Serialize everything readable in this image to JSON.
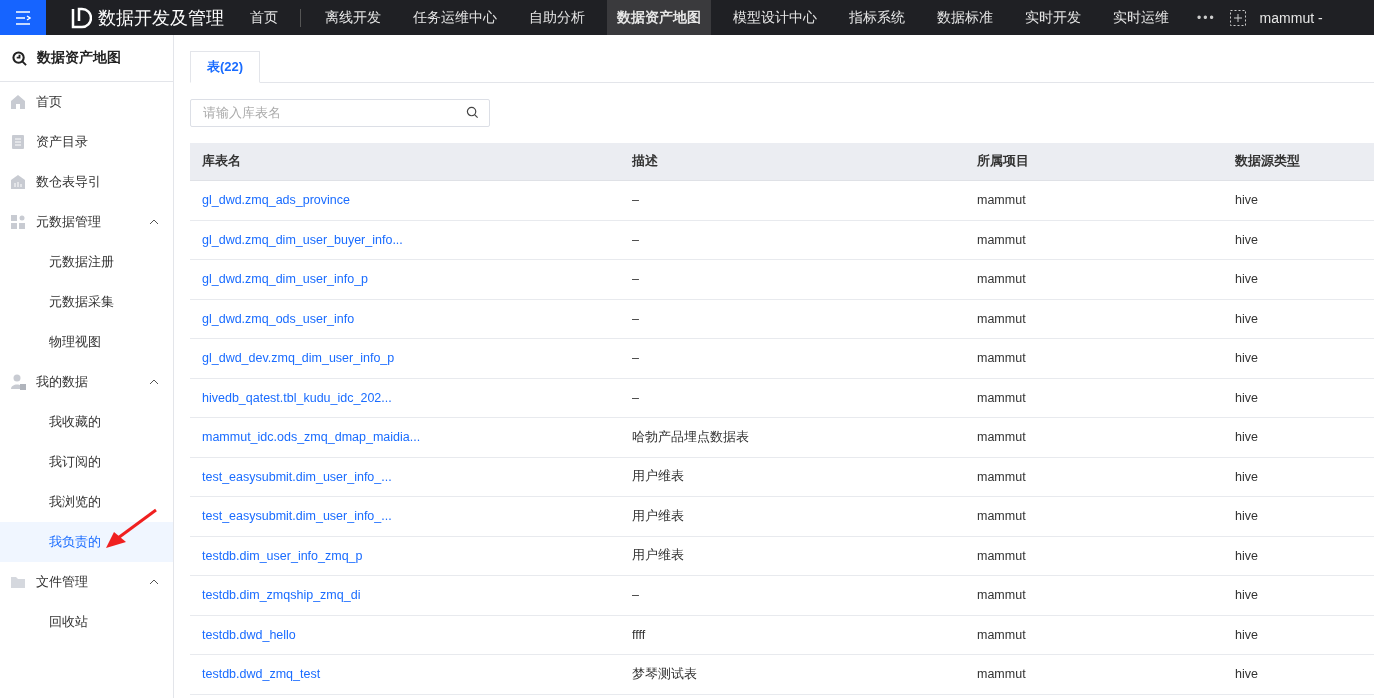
{
  "top_bar": {
    "app_title": "数据开发及管理",
    "nav": [
      {
        "label": "首页",
        "selected": false
      },
      {
        "label": "离线开发",
        "selected": false
      },
      {
        "label": "任务运维中心",
        "selected": false
      },
      {
        "label": "自助分析",
        "selected": false
      },
      {
        "label": "数据资产地图",
        "selected": true
      },
      {
        "label": "模型设计中心",
        "selected": false
      },
      {
        "label": "指标系统",
        "selected": false
      },
      {
        "label": "数据标准",
        "selected": false
      },
      {
        "label": "实时开发",
        "selected": false
      },
      {
        "label": "实时运维",
        "selected": false
      }
    ],
    "more": "•••",
    "user": "mammut -"
  },
  "sidebar": {
    "title": "数据资产地图",
    "items": [
      {
        "label": "首页",
        "selected": false
      },
      {
        "label": "资产目录",
        "selected": false
      },
      {
        "label": "数仓表导引",
        "selected": false
      },
      {
        "label": "元数据管理",
        "expanded": true,
        "children": [
          {
            "label": "元数据注册",
            "selected": false
          },
          {
            "label": "元数据采集",
            "selected": false
          },
          {
            "label": "物理视图",
            "selected": false
          }
        ]
      },
      {
        "label": "我的数据",
        "expanded": true,
        "children": [
          {
            "label": "我收藏的",
            "selected": false
          },
          {
            "label": "我订阅的",
            "selected": false
          },
          {
            "label": "我浏览的",
            "selected": false
          },
          {
            "label": "我负责的",
            "selected": true
          }
        ]
      },
      {
        "label": "文件管理",
        "expanded": true,
        "children": [
          {
            "label": "回收站",
            "selected": false
          }
        ]
      }
    ]
  },
  "tabs": [
    {
      "label": "表(22)",
      "selected": true
    }
  ],
  "search": {
    "placeholder": "请输入库表名"
  },
  "table": {
    "columns": [
      "库表名",
      "描述",
      "所属项目",
      "数据源类型"
    ],
    "rows": [
      [
        "gl_dwd.zmq_ads_province",
        "–",
        "mammut",
        "hive"
      ],
      [
        "gl_dwd.zmq_dim_user_buyer_info...",
        "–",
        "mammut",
        "hive"
      ],
      [
        "gl_dwd.zmq_dim_user_info_p",
        "–",
        "mammut",
        "hive"
      ],
      [
        "gl_dwd.zmq_ods_user_info",
        "–",
        "mammut",
        "hive"
      ],
      [
        "gl_dwd_dev.zmq_dim_user_info_p",
        "–",
        "mammut",
        "hive"
      ],
      [
        "hivedb_qatest.tbl_kudu_idc_202...",
        "–",
        "mammut",
        "hive"
      ],
      [
        "mammut_idc.ods_zmq_dmap_maidia...",
        "哈勃产品埋点数据表",
        "mammut",
        "hive"
      ],
      [
        "test_easysubmit.dim_user_info_...",
        "用户维表",
        "mammut",
        "hive"
      ],
      [
        "test_easysubmit.dim_user_info_...",
        "用户维表",
        "mammut",
        "hive"
      ],
      [
        "testdb.dim_user_info_zmq_p",
        "用户维表",
        "mammut",
        "hive"
      ],
      [
        "testdb.dim_zmqship_zmq_di",
        "–",
        "mammut",
        "hive"
      ],
      [
        "testdb.dwd_hello",
        "ffff",
        "mammut",
        "hive"
      ],
      [
        "testdb.dwd_zmq_test",
        "梦琴测试表",
        "mammut",
        "hive"
      ]
    ]
  }
}
